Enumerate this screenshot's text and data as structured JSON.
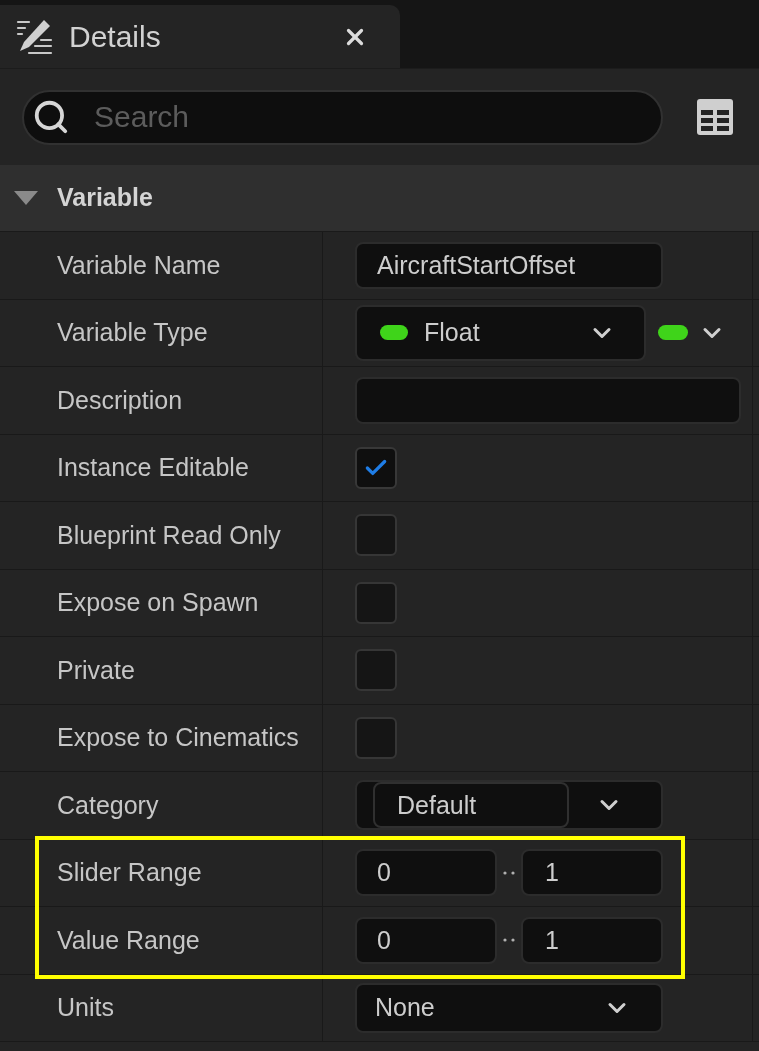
{
  "tab": {
    "title": "Details"
  },
  "search": {
    "placeholder": "Search"
  },
  "section": {
    "title": "Variable",
    "expanded": true
  },
  "rows": [
    {
      "label": "Variable Name",
      "kind": "text",
      "value": "AircraftStartOffset"
    },
    {
      "label": "Variable Type",
      "kind": "type",
      "value": "Float",
      "color": "#3fd41a"
    },
    {
      "label": "Description",
      "kind": "textarea"
    },
    {
      "label": "Instance Editable",
      "kind": "checkbox",
      "checked": true
    },
    {
      "label": "Blueprint Read Only",
      "kind": "checkbox",
      "checked": false
    },
    {
      "label": "Expose on Spawn",
      "kind": "checkbox",
      "checked": false
    },
    {
      "label": "Private",
      "kind": "checkbox",
      "checked": false
    },
    {
      "label": "Expose to Cinematics",
      "kind": "checkbox",
      "checked": false
    },
    {
      "label": "Category",
      "kind": "combo",
      "value": "Default"
    },
    {
      "label": "Slider Range",
      "kind": "range",
      "min": "0",
      "max": "1",
      "highlighted": true
    },
    {
      "label": "Value Range",
      "kind": "range",
      "min": "0",
      "max": "1",
      "highlighted": true
    },
    {
      "label": "Units",
      "kind": "dropdown",
      "value": "None"
    }
  ]
}
